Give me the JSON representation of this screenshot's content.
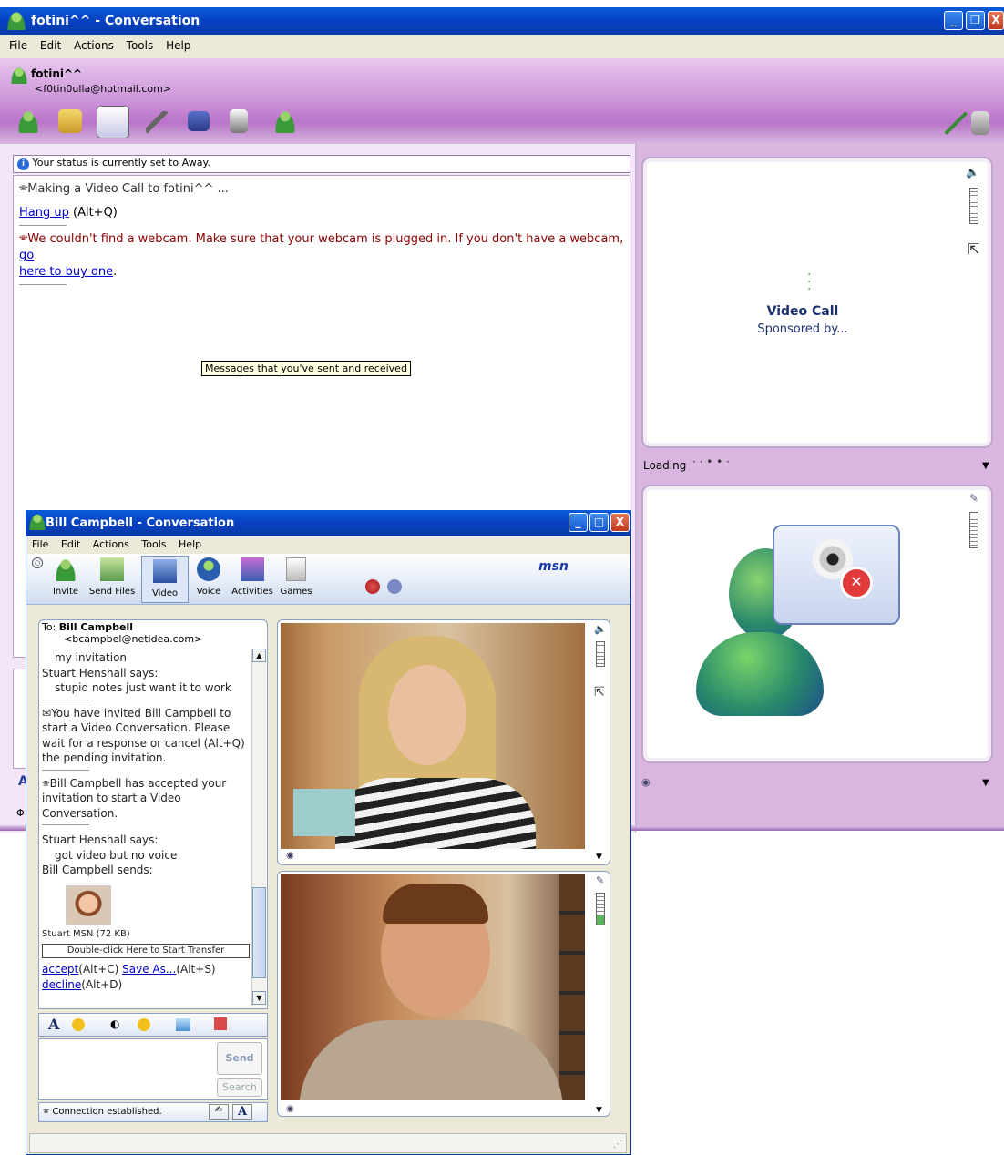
{
  "main": {
    "title": "fotini^^ - Conversation",
    "menu": [
      "File",
      "Edit",
      "Actions",
      "Tools",
      "Help"
    ],
    "contact_name": "fotini^^",
    "contact_email": "<f0tin0ulla@hotmail.com>",
    "status_notice": "Your status is currently set to Away.",
    "calling_msg": "Making a Video Call to fotini^^ ...",
    "hangup_link": "Hang up",
    "hangup_shortcut": "(Alt+Q)",
    "webcam_msg": "We couldn't find a webcam. Make sure that your webcam is plugged in. If you don't have a webcam,",
    "buy_link_part1": "go",
    "buy_link_part2": "here to buy one",
    "buy_period": ".",
    "tooltip": "Messages that you've sent and received",
    "video_call_title": "Video Call",
    "sponsored": "Sponsored by...",
    "loading": "Loading",
    "partial_bottom_a": "A",
    "partial_bottom_phi": "Φ"
  },
  "bill": {
    "title": "Bill Campbell - Conversation",
    "menu": [
      "File",
      "Edit",
      "Actions",
      "Tools",
      "Help"
    ],
    "toolbar": [
      "Invite",
      "Send Files",
      "Video",
      "Voice",
      "Activities",
      "Games"
    ],
    "brand": "msn",
    "to_label": "To:",
    "to_name": "Bill Campbell",
    "to_email": "<bcampbel@netidea.com>",
    "line_invitation": "my invitation",
    "says_1": "Stuart Henshall says:",
    "msg_1": "stupid notes just want it to work",
    "invite_msg": "You have invited Bill Campbell to start a Video Conversation. Please wait for a response or cancel (Alt+Q) the pending invitation.",
    "accepted_msg": "Bill Campbell has accepted your invitation to start a Video Conversation.",
    "says_2": "Stuart Henshall says:",
    "msg_2": "got video but no voice",
    "sends": "Bill Campbell sends:",
    "file_name": "Stuart MSN (72 KB)",
    "transfer_btn": "Double-click Here to Start Transfer",
    "accept_link": "accept",
    "accept_sc": "(Alt+C)",
    "saveas_link": "Save As...",
    "saveas_sc": "(Alt+S)",
    "decline_link": "decline",
    "decline_sc": "(Alt+D)",
    "send_btn": "Send",
    "search_btn": "Search",
    "status": "Connection established.",
    "font_btn": "A"
  },
  "colors": {
    "xp_blue": "#0a4fd6",
    "msn_purple": "#d8b6e0",
    "link": "#0000cc",
    "error": "#8b0000"
  }
}
